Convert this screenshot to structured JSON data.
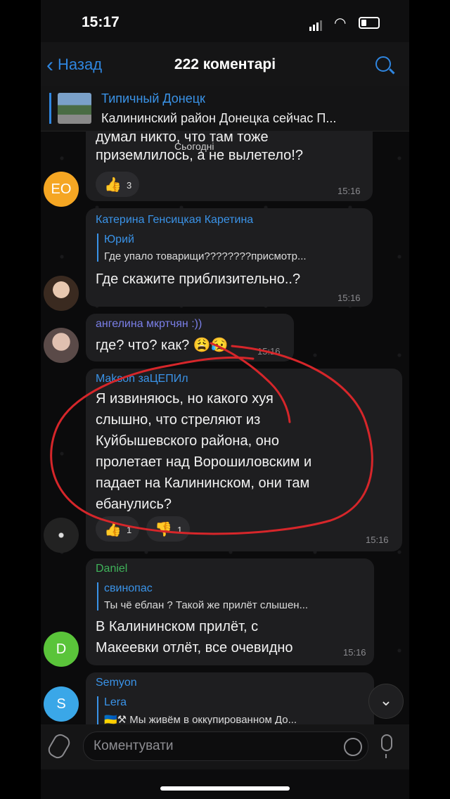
{
  "status_bar": {
    "time": "15:17"
  },
  "header": {
    "back_label": "Назад",
    "title": "222 коментарі"
  },
  "pinned": {
    "channel": "Типичный Донецк",
    "text": "Калининский район Донецка сейчас  П..."
  },
  "date_label": "Сьогодні",
  "messages": [
    {
      "text_top": "думал никто, что там тоже",
      "text": "приземлилось, а не вылетело!?",
      "reaction": {
        "emoji": "👍",
        "count": "3"
      },
      "time": "15:16",
      "avatar_initials": "EO",
      "avatar_color": "#f5a623"
    },
    {
      "sender": "Катерина Генсицкая Каретина",
      "sender_color": "#3a93e8",
      "reply_name": "Юрий",
      "reply_text": "Где упало товарищи????????присмотр...",
      "text": "Где скажите приблизительно..?",
      "time": "15:16"
    },
    {
      "sender": "ангелина мкртчян :))",
      "sender_color": "#7a7fe8",
      "text": "где? что? как? 😩😥",
      "time": "15:16"
    },
    {
      "sender": "Makson заЦЕПИл",
      "sender_color": "#3a93e8",
      "text": "Я извиняюсь, но какого хуя\nслышно, что стреляют из\nКуйбышевского района, оно\nпролетает над Ворошиловским и\nпадает на Калининском, они там\nебанулись?",
      "reactions": [
        {
          "emoji": "👍",
          "count": "1"
        },
        {
          "emoji": "👎",
          "count": "1"
        }
      ],
      "time": "15:16"
    },
    {
      "sender": "Daniel",
      "sender_color": "#3fb35a",
      "reply_name": "свинопас",
      "reply_text": "Ты чё еблан ? Такой же прилёт слышен...",
      "text": "В Калининском прилёт, с\nМакеевки отлёт, все очевидно",
      "time": "15:16",
      "avatar_initials": "D",
      "avatar_color": "#5ac43a"
    },
    {
      "sender": "Semyon",
      "sender_color": "#3a93e8",
      "reply_name": "Lera",
      "reply_text": "🇺🇦⚒ Мы живём в оккупированном До...",
      "avatar_initials": "S",
      "avatar_color": "#3aa7e8"
    }
  ],
  "input": {
    "placeholder": "Коментувати"
  }
}
